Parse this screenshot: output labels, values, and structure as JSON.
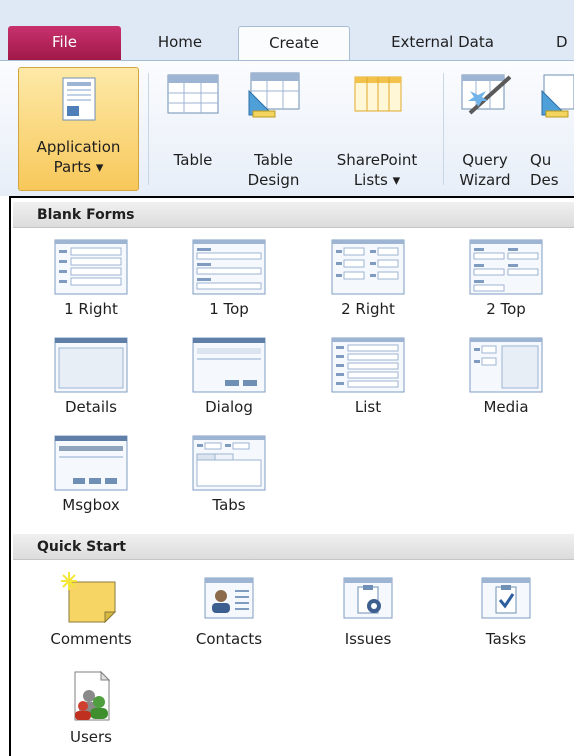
{
  "tabs": {
    "file": "File",
    "home": "Home",
    "create": "Create",
    "external_data": "External Data",
    "database_tools_partial": "D"
  },
  "ribbon": {
    "application_parts": {
      "line1": "Application",
      "line2": "Parts ▾"
    },
    "table": {
      "line1": "Table"
    },
    "table_design": {
      "line1": "Table",
      "line2": "Design"
    },
    "sharepoint_lists": {
      "line1": "SharePoint",
      "line2": "Lists ▾"
    },
    "query_wizard": {
      "line1": "Query",
      "line2": "Wizard"
    },
    "query_design_partial": {
      "line1": "Qu",
      "line2": "Des"
    }
  },
  "blank_forms": {
    "heading": "Blank Forms",
    "items": [
      {
        "label": "1 Right",
        "icon": "form-1-right-icon"
      },
      {
        "label": "1 Top",
        "icon": "form-1-top-icon"
      },
      {
        "label": "2 Right",
        "icon": "form-2-right-icon"
      },
      {
        "label": "2 Top",
        "icon": "form-2-top-icon"
      },
      {
        "label": "Details",
        "icon": "form-details-icon"
      },
      {
        "label": "Dialog",
        "icon": "form-dialog-icon"
      },
      {
        "label": "List",
        "icon": "form-list-icon"
      },
      {
        "label": "Media",
        "icon": "form-media-icon"
      },
      {
        "label": "Msgbox",
        "icon": "form-msgbox-icon"
      },
      {
        "label": "Tabs",
        "icon": "form-tabs-icon"
      }
    ]
  },
  "quick_start": {
    "heading": "Quick Start",
    "items": [
      {
        "label": "Comments",
        "icon": "comments-icon"
      },
      {
        "label": "Contacts",
        "icon": "contacts-icon"
      },
      {
        "label": "Issues",
        "icon": "issues-icon"
      },
      {
        "label": "Tasks",
        "icon": "tasks-icon"
      },
      {
        "label": "Users",
        "icon": "users-icon"
      }
    ]
  },
  "colors": {
    "file_tab": "#b3245b",
    "ribbon_bg": "#e7eef8",
    "selected_button": "#f8c85a"
  }
}
